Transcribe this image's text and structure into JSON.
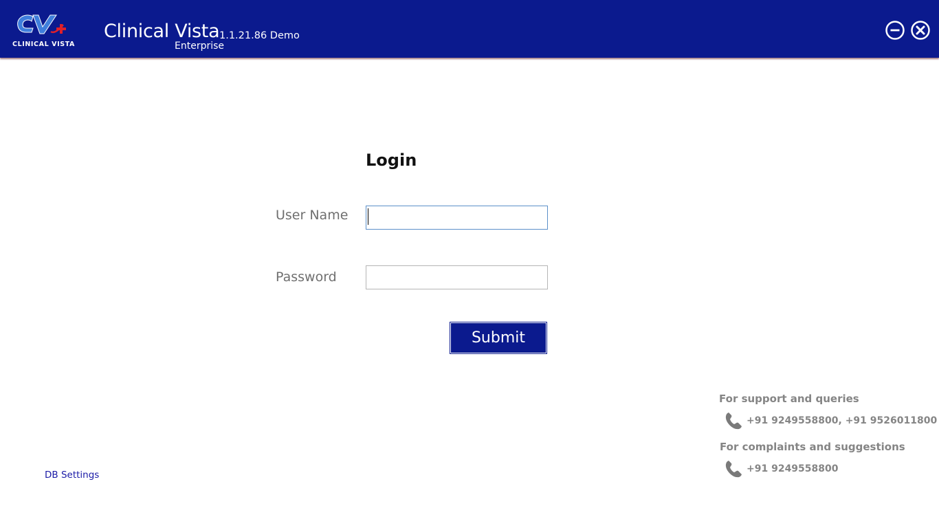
{
  "header": {
    "logo_text": "CV+",
    "logo_subtitle": "CLINICAL VISTA",
    "app_name": "Clinical Vista",
    "version": "1.1.21.86 Demo",
    "edition": "Enterprise",
    "minimize_icon": "minimize-circle-icon",
    "close_icon": "close-circle-icon"
  },
  "login": {
    "title": "Login",
    "username_label": "User Name",
    "username_value": "",
    "password_label": "Password",
    "password_value": "",
    "submit_label": "Submit"
  },
  "footer": {
    "db_settings_link": "DB Settings"
  },
  "support": {
    "support_heading": "For support and queries",
    "support_phones": "+91 9249558800, +91 9526011800",
    "complaints_heading": "For complaints and suggestions",
    "complaints_phone": "+91 9249558800",
    "phone_icon": "phone-icon"
  },
  "colors": {
    "header_bg": "#0b1a8e",
    "accent_red": "#e0202a",
    "text_gray": "#858585",
    "link_blue": "#1a1aa6"
  }
}
